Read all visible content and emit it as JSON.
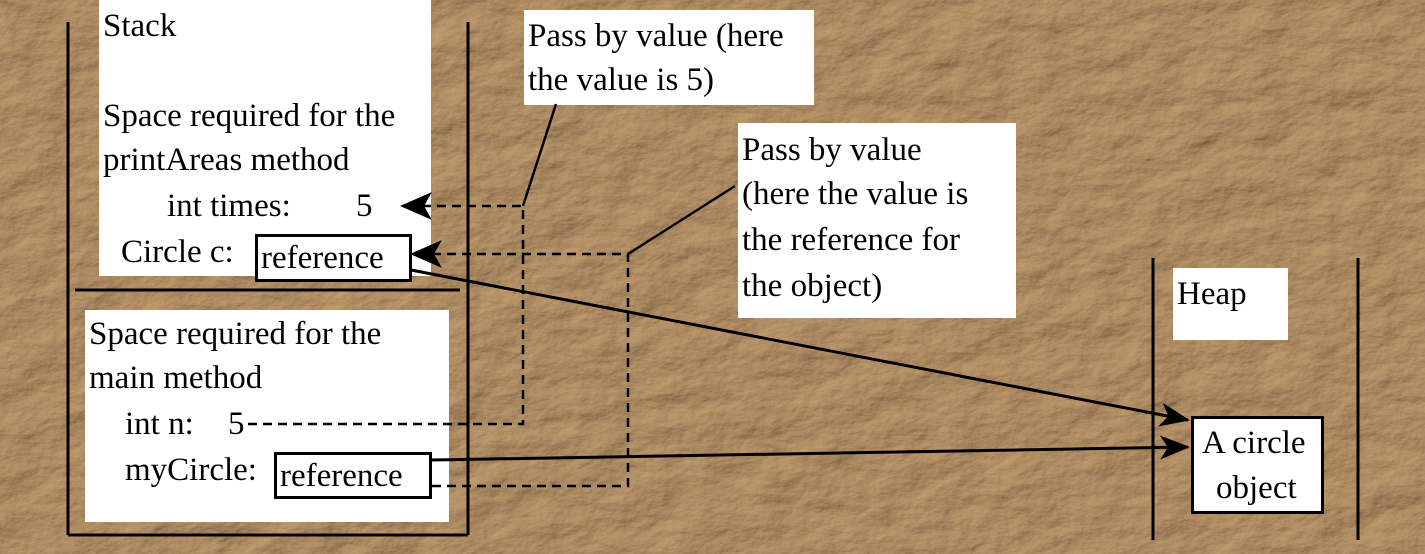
{
  "background": {
    "texture": "crumpled-brown-paper",
    "base_color": "#b48c5e"
  },
  "stack": {
    "title": "Stack",
    "print_areas_frame": {
      "heading_line1": "Space required for the",
      "heading_line2": "printAreas method",
      "times_label": "int  times:",
      "times_value": "5",
      "circle_label": "Circle c:",
      "circle_value": "reference"
    },
    "main_frame": {
      "heading_line1": "Space required for the",
      "heading_line2": "main method",
      "n_label": "int  n:",
      "n_value": "5",
      "mycircle_label": "myCircle:",
      "mycircle_value": "reference"
    }
  },
  "callouts": {
    "value_note_line1": "Pass by value (here",
    "value_note_line2": "the value is 5)",
    "reference_note_line1": "Pass by value",
    "reference_note_line2": "(here the value is",
    "reference_note_line3": "the reference for",
    "reference_note_line4": "the object)"
  },
  "heap": {
    "title": "Heap",
    "object_line1": "A circle",
    "object_line2": "object"
  }
}
